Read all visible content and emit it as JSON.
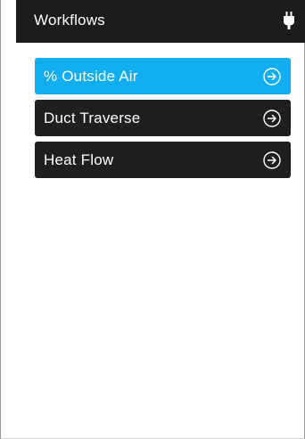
{
  "header": {
    "title": "Workflows",
    "status_icon": "plug-icon"
  },
  "workflows": [
    {
      "label": "% Outside Air",
      "state": "active",
      "icon": "arrow-circle-right-icon"
    },
    {
      "label": "Duct Traverse",
      "state": "normal",
      "icon": "arrow-circle-right-icon"
    },
    {
      "label": "Heat Flow",
      "state": "normal",
      "icon": "arrow-circle-right-icon"
    }
  ],
  "colors": {
    "header_bg": "#1c1c1c",
    "active_button": "#10aef0",
    "button_bg": "#1f1f1f",
    "text": "#ffffff"
  }
}
